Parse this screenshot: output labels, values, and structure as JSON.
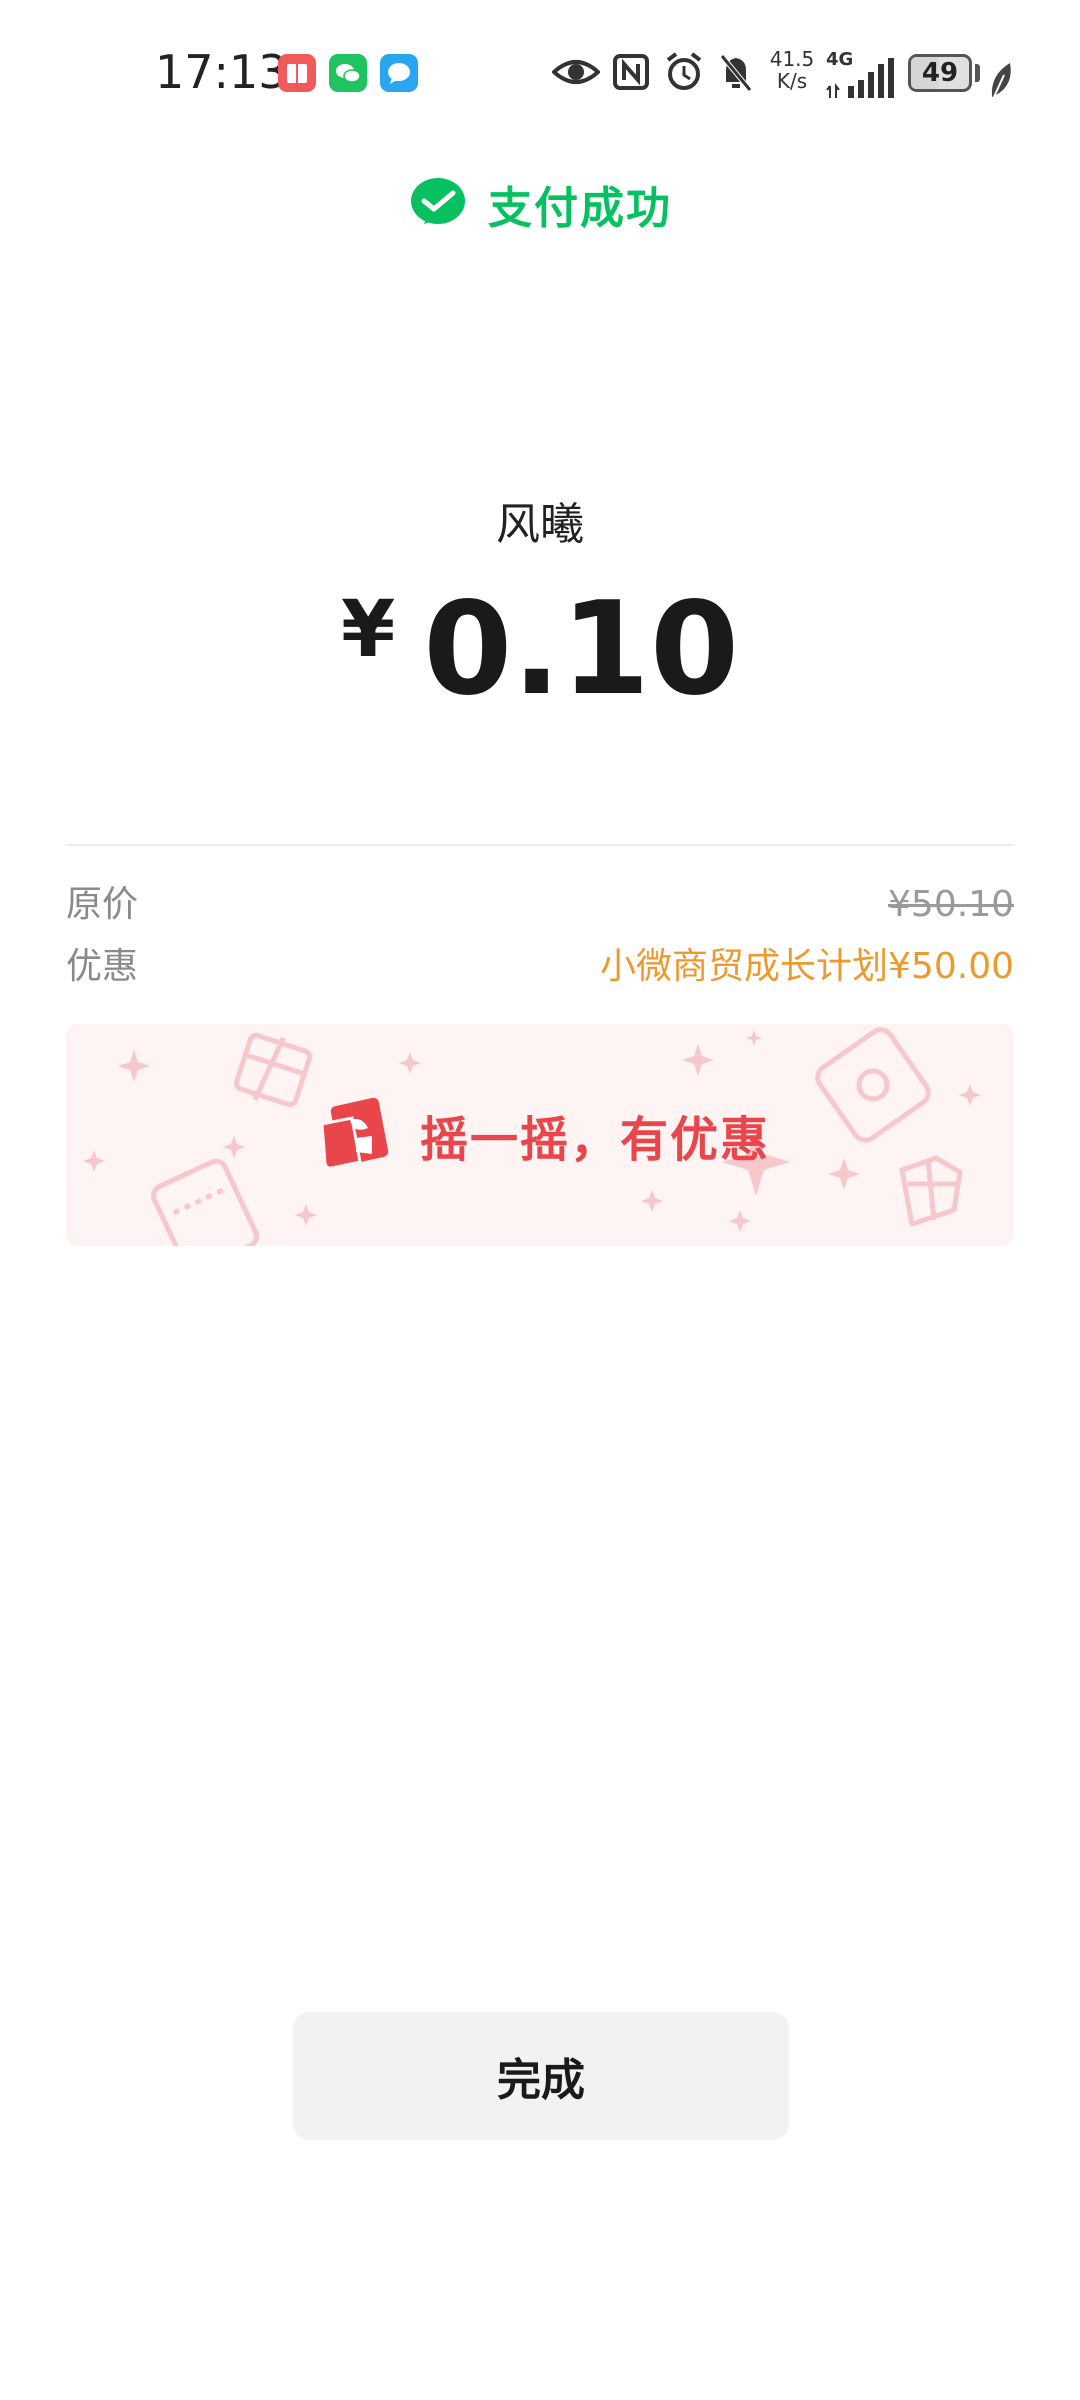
{
  "status_bar": {
    "time": "17:13",
    "net_speed_value": "41.5",
    "net_speed_unit": "K/s",
    "network": "4G",
    "battery": "49",
    "battery_level": 0.49,
    "notification_apps": [
      "reader-app-icon",
      "wechat-app-icon",
      "message-app-icon"
    ],
    "system_icons": [
      "eye-icon",
      "nfc-icon",
      "alarm-icon",
      "mute-icon",
      "signal-icon",
      "leaf-icon"
    ]
  },
  "header": {
    "title": "支付成功",
    "icon": "wechat-pay-check-icon",
    "color": "#07c160"
  },
  "payment": {
    "merchant": "风曦",
    "currency": "¥",
    "amount": "0.10"
  },
  "details": {
    "original_label": "原价",
    "original_value": "¥50.10",
    "discount_label": "优惠",
    "discount_value": "小微商贸成长计划¥50.00",
    "discount_color": "#ec9a2e"
  },
  "promo": {
    "text": "摇一摇，有优惠",
    "icon": "shake-red-packet-icon",
    "text_color": "#e8464a",
    "background": "#fff4f4"
  },
  "actions": {
    "done_label": "完成"
  }
}
